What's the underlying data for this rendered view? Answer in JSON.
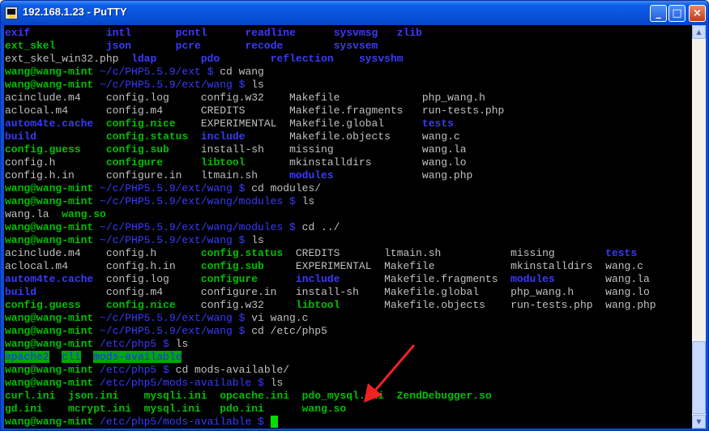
{
  "window": {
    "title": "192.168.1.23 - PuTTY",
    "controls": {
      "minimize": "_",
      "maximize": "□",
      "close": "×"
    }
  },
  "terminal": {
    "lines": [
      {
        "segments": [
          {
            "t": "exif",
            "c": "b"
          },
          {
            "t": "            "
          },
          {
            "t": "intl",
            "c": "b"
          },
          {
            "t": "       "
          },
          {
            "t": "pcntl",
            "c": "b"
          },
          {
            "t": "      "
          },
          {
            "t": "readline",
            "c": "b"
          },
          {
            "t": "      "
          },
          {
            "t": "sysvmsg",
            "c": "b"
          },
          {
            "t": "   "
          },
          {
            "t": "zlib",
            "c": "b"
          }
        ]
      },
      {
        "segments": [
          {
            "t": "ext_skel",
            "c": "g"
          },
          {
            "t": "        "
          },
          {
            "t": "json",
            "c": "b"
          },
          {
            "t": "       "
          },
          {
            "t": "pcre",
            "c": "b"
          },
          {
            "t": "       "
          },
          {
            "t": "recode",
            "c": "b"
          },
          {
            "t": "        "
          },
          {
            "t": "sysvsem",
            "c": "b"
          }
        ]
      },
      {
        "segments": [
          {
            "t": "ext_skel_win32.php",
            "c": "w"
          },
          {
            "t": "  "
          },
          {
            "t": "ldap",
            "c": "b"
          },
          {
            "t": "       "
          },
          {
            "t": "pdo",
            "c": "b"
          },
          {
            "t": "        "
          },
          {
            "t": "reflection",
            "c": "b"
          },
          {
            "t": "    "
          },
          {
            "t": "sysvshm",
            "c": "b"
          }
        ]
      },
      {
        "segments": [
          {
            "t": "wang@wang-mint",
            "c": "g"
          },
          {
            "t": " ~/c/PHP5.5.9/ext $",
            "c": "bn"
          },
          {
            "t": " cd wang",
            "c": "w"
          }
        ]
      },
      {
        "segments": [
          {
            "t": "wang@wang-mint",
            "c": "g"
          },
          {
            "t": " ~/c/PHP5.5.9/ext/wang $",
            "c": "bn"
          },
          {
            "t": " ls",
            "c": "w"
          }
        ]
      },
      {
        "segments": [
          {
            "t": "acinclude.m4    config.log     config.w32    Makefile             php_wang.h",
            "c": "w"
          }
        ]
      },
      {
        "segments": [
          {
            "t": "aclocal.m4      config.m4      CREDITS       Makefile.fragments   run-tests.php",
            "c": "w"
          }
        ]
      },
      {
        "segments": [
          {
            "t": "autom4te.cache",
            "c": "b"
          },
          {
            "t": "  "
          },
          {
            "t": "config.nice",
            "c": "g"
          },
          {
            "t": "    "
          },
          {
            "t": "EXPERIMENTAL  Makefile.global      ",
            "c": "w"
          },
          {
            "t": "tests",
            "c": "b"
          }
        ]
      },
      {
        "segments": [
          {
            "t": "build",
            "c": "b"
          },
          {
            "t": "           "
          },
          {
            "t": "config.status",
            "c": "g"
          },
          {
            "t": "  "
          },
          {
            "t": "include",
            "c": "b"
          },
          {
            "t": "       "
          },
          {
            "t": "Makefile.objects     wang.c",
            "c": "w"
          }
        ]
      },
      {
        "segments": [
          {
            "t": "config.guess",
            "c": "g"
          },
          {
            "t": "    "
          },
          {
            "t": "config.sub",
            "c": "g"
          },
          {
            "t": "     "
          },
          {
            "t": "install-sh    missing              wang.la",
            "c": "w"
          }
        ]
      },
      {
        "segments": [
          {
            "t": "config.h        ",
            "c": "w"
          },
          {
            "t": "configure",
            "c": "g"
          },
          {
            "t": "      "
          },
          {
            "t": "libtool",
            "c": "g"
          },
          {
            "t": "       "
          },
          {
            "t": "mkinstalldirs        wang.lo",
            "c": "w"
          }
        ]
      },
      {
        "segments": [
          {
            "t": "config.h.in     configure.in   ltmain.sh     ",
            "c": "w"
          },
          {
            "t": "modules",
            "c": "b"
          },
          {
            "t": "              "
          },
          {
            "t": "wang.php",
            "c": "w"
          }
        ]
      },
      {
        "segments": [
          {
            "t": "wang@wang-mint",
            "c": "g"
          },
          {
            "t": " ~/c/PHP5.5.9/ext/wang $",
            "c": "bn"
          },
          {
            "t": " cd modules/",
            "c": "w"
          }
        ]
      },
      {
        "segments": [
          {
            "t": "wang@wang-mint",
            "c": "g"
          },
          {
            "t": " ~/c/PHP5.5.9/ext/wang/modules $",
            "c": "bn"
          },
          {
            "t": " ls",
            "c": "w"
          }
        ]
      },
      {
        "segments": [
          {
            "t": "wang.la  ",
            "c": "w"
          },
          {
            "t": "wang.so",
            "c": "g"
          }
        ]
      },
      {
        "segments": [
          {
            "t": "wang@wang-mint",
            "c": "g"
          },
          {
            "t": " ~/c/PHP5.5.9/ext/wang/modules $",
            "c": "bn"
          },
          {
            "t": " cd ../",
            "c": "w"
          }
        ]
      },
      {
        "segments": [
          {
            "t": "wang@wang-mint",
            "c": "g"
          },
          {
            "t": " ~/c/PHP5.5.9/ext/wang $",
            "c": "bn"
          },
          {
            "t": " ls",
            "c": "w"
          }
        ]
      },
      {
        "segments": [
          {
            "t": "acinclude.m4    config.h       ",
            "c": "w"
          },
          {
            "t": "config.status",
            "c": "g"
          },
          {
            "t": "  "
          },
          {
            "t": "CREDITS       ltmain.sh           missing        ",
            "c": "w"
          },
          {
            "t": "tests",
            "c": "b"
          }
        ]
      },
      {
        "segments": [
          {
            "t": "aclocal.m4      config.h.in    ",
            "c": "w"
          },
          {
            "t": "config.sub",
            "c": "g"
          },
          {
            "t": "     "
          },
          {
            "t": "EXPERIMENTAL  Makefile            mkinstalldirs  wang.c",
            "c": "w"
          }
        ]
      },
      {
        "segments": [
          {
            "t": "autom4te.cache",
            "c": "b"
          },
          {
            "t": "  "
          },
          {
            "t": "config.log     ",
            "c": "w"
          },
          {
            "t": "configure",
            "c": "g"
          },
          {
            "t": "      "
          },
          {
            "t": "include",
            "c": "b"
          },
          {
            "t": "       "
          },
          {
            "t": "Makefile.fragments  ",
            "c": "w"
          },
          {
            "t": "modules",
            "c": "b"
          },
          {
            "t": "        "
          },
          {
            "t": "wang.la",
            "c": "w"
          }
        ]
      },
      {
        "segments": [
          {
            "t": "build",
            "c": "b"
          },
          {
            "t": "           "
          },
          {
            "t": "config.m4      configure.in   install-sh    Makefile.global     php_wang.h     wang.lo",
            "c": "w"
          }
        ]
      },
      {
        "segments": [
          {
            "t": "config.guess",
            "c": "g"
          },
          {
            "t": "    "
          },
          {
            "t": "config.nice",
            "c": "g"
          },
          {
            "t": "    "
          },
          {
            "t": "config.w32     ",
            "c": "w"
          },
          {
            "t": "libtool",
            "c": "g"
          },
          {
            "t": "       "
          },
          {
            "t": "Makefile.objects    run-tests.php  wang.php",
            "c": "w"
          }
        ]
      },
      {
        "segments": [
          {
            "t": "wang@wang-mint",
            "c": "g"
          },
          {
            "t": " ~/c/PHP5.5.9/ext/wang $",
            "c": "bn"
          },
          {
            "t": " vi wang.c",
            "c": "w"
          }
        ]
      },
      {
        "segments": [
          {
            "t": "wang@wang-mint",
            "c": "g"
          },
          {
            "t": " ~/c/PHP5.5.9/ext/wang $",
            "c": "bn"
          },
          {
            "t": " cd /etc/php5",
            "c": "w"
          }
        ]
      },
      {
        "segments": [
          {
            "t": "wang@wang-mint",
            "c": "g"
          },
          {
            "t": " /etc/php5 $",
            "c": "bn"
          },
          {
            "t": " ls",
            "c": "w"
          }
        ]
      },
      {
        "segments": [
          {
            "t": "apache2",
            "c": "hl"
          },
          {
            "t": "  "
          },
          {
            "t": "cli",
            "c": "hl"
          },
          {
            "t": "  "
          },
          {
            "t": "mods-available",
            "c": "hl"
          }
        ]
      },
      {
        "segments": [
          {
            "t": "wang@wang-mint",
            "c": "g"
          },
          {
            "t": " /etc/php5 $",
            "c": "bn"
          },
          {
            "t": " cd mods-available/",
            "c": "w"
          }
        ]
      },
      {
        "segments": [
          {
            "t": "wang@wang-mint",
            "c": "g"
          },
          {
            "t": " /etc/php5/mods-available $",
            "c": "bn"
          },
          {
            "t": " ls",
            "c": "w"
          }
        ]
      },
      {
        "segments": [
          {
            "t": "curl.ini  json.ini    mysqli.ini  opcache.ini  pdo_mysql.ini  ZendDebugger.so",
            "c": "g"
          }
        ]
      },
      {
        "segments": [
          {
            "t": "gd.ini    mcrypt.ini  mysql.ini   pdo.ini      wang.so",
            "c": "g"
          }
        ]
      },
      {
        "segments": [
          {
            "t": "wang@wang-mint",
            "c": "g"
          },
          {
            "t": " /etc/php5/mods-available $",
            "c": "bn"
          },
          {
            "t": " ",
            "c": "w"
          }
        ],
        "cursor": true
      }
    ]
  },
  "colors": {
    "terminal_bg": "#000000",
    "prompt_user": "#00c000",
    "prompt_path": "#3a3aff",
    "directory": "#3a3aff",
    "executable": "#00c000",
    "annotation_arrow": "#ee2222"
  },
  "icons": [
    "putty-app-icon",
    "minimize-icon",
    "maximize-icon",
    "close-icon",
    "scroll-up-icon",
    "scroll-down-icon",
    "annotation-arrow"
  ]
}
